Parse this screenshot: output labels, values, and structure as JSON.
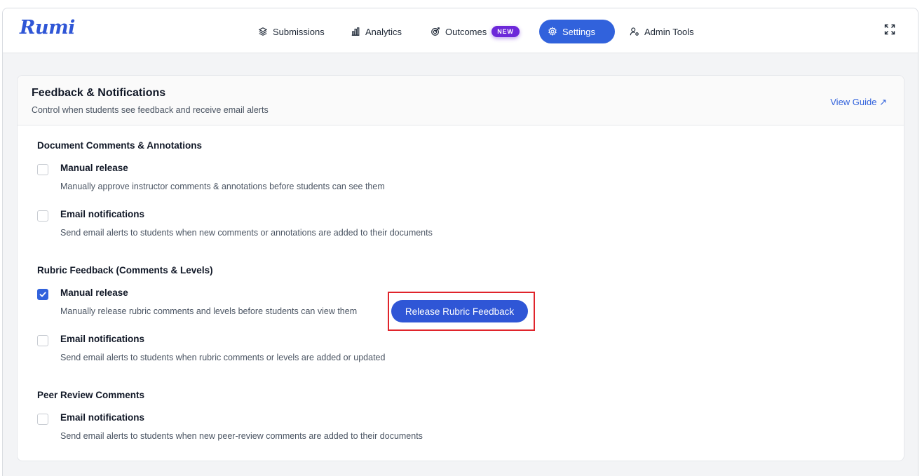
{
  "app": {
    "logo": "Rumi"
  },
  "nav": {
    "submissions": "Submissions",
    "analytics": "Analytics",
    "outcomes": "Outcomes",
    "outcomes_badge": "NEW",
    "settings": "Settings",
    "admin_tools": "Admin Tools"
  },
  "colors": {
    "accent": "#3162dc",
    "badge": "#6d28d9",
    "highlight": "#e0242b"
  },
  "card": {
    "title": "Feedback & Notifications",
    "subtitle": "Control when students see feedback and receive email alerts",
    "guide_link": "View Guide ↗"
  },
  "sections": {
    "document": {
      "title": "Document Comments & Annotations",
      "manual": {
        "label": "Manual release",
        "desc": "Manually approve instructor comments & annotations before students can see them",
        "checked": false
      },
      "email": {
        "label": "Email notifications",
        "desc": "Send email alerts to students when new comments or annotations are added to their documents",
        "checked": false
      }
    },
    "rubric": {
      "title": "Rubric Feedback (Comments & Levels)",
      "manual": {
        "label": "Manual release",
        "desc": "Manually release rubric comments and levels before students can view them",
        "checked": true
      },
      "release_button": "Release Rubric Feedback",
      "email": {
        "label": "Email notifications",
        "desc": "Send email alerts to students when rubric comments or levels are added or updated",
        "checked": false
      }
    },
    "peer": {
      "title": "Peer Review Comments",
      "email": {
        "label": "Email notifications",
        "desc": "Send email alerts to students when new peer-review comments are added to their documents",
        "checked": false
      }
    }
  }
}
